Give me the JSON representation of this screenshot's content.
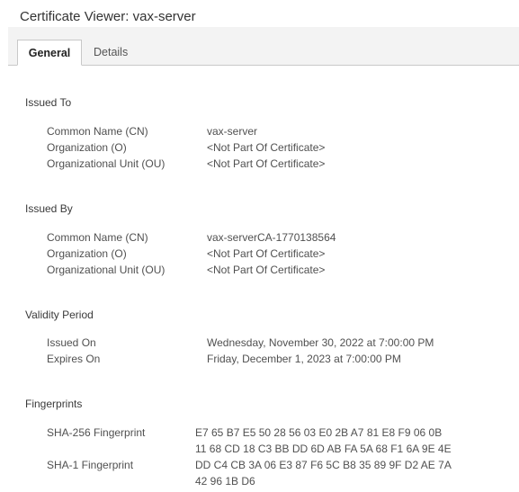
{
  "window": {
    "title": "Certificate Viewer: vax-server"
  },
  "tabs": [
    {
      "label": "General",
      "selected": true
    },
    {
      "label": "Details",
      "selected": false
    }
  ],
  "issued_to": {
    "heading": "Issued To",
    "fields": [
      {
        "label": "Common Name (CN)",
        "value": "vax-server"
      },
      {
        "label": "Organization (O)",
        "value": "<Not Part Of Certificate>"
      },
      {
        "label": "Organizational Unit (OU)",
        "value": "<Not Part Of Certificate>"
      }
    ]
  },
  "issued_by": {
    "heading": "Issued By",
    "fields": [
      {
        "label": "Common Name (CN)",
        "value": "vax-serverCA-1770138564"
      },
      {
        "label": "Organization (O)",
        "value": "<Not Part Of Certificate>"
      },
      {
        "label": "Organizational Unit (OU)",
        "value": "<Not Part Of Certificate>"
      }
    ]
  },
  "validity": {
    "heading": "Validity Period",
    "fields": [
      {
        "label": "Issued On",
        "value": "Wednesday, November 30, 2022 at 7:00:00 PM"
      },
      {
        "label": "Expires On",
        "value": "Friday, December 1, 2023 at 7:00:00 PM"
      }
    ]
  },
  "fingerprints": {
    "heading": "Fingerprints",
    "sha256": {
      "label": "SHA-256 Fingerprint",
      "line1": "E7 65 B7 E5 50 28 56 03 E0 2B A7 81 E8 F9 06 0B",
      "line2": "11 68 CD 18 C3 BB DD 6D AB FA 5A 68 F1 6A 9E 4E"
    },
    "sha1": {
      "label": "SHA-1 Fingerprint",
      "line1": "DD C4 CB 3A 06 E3 87 F6 5C B8 35 89 9F D2 AE 7A",
      "line2": "42 96 1B D6"
    }
  }
}
